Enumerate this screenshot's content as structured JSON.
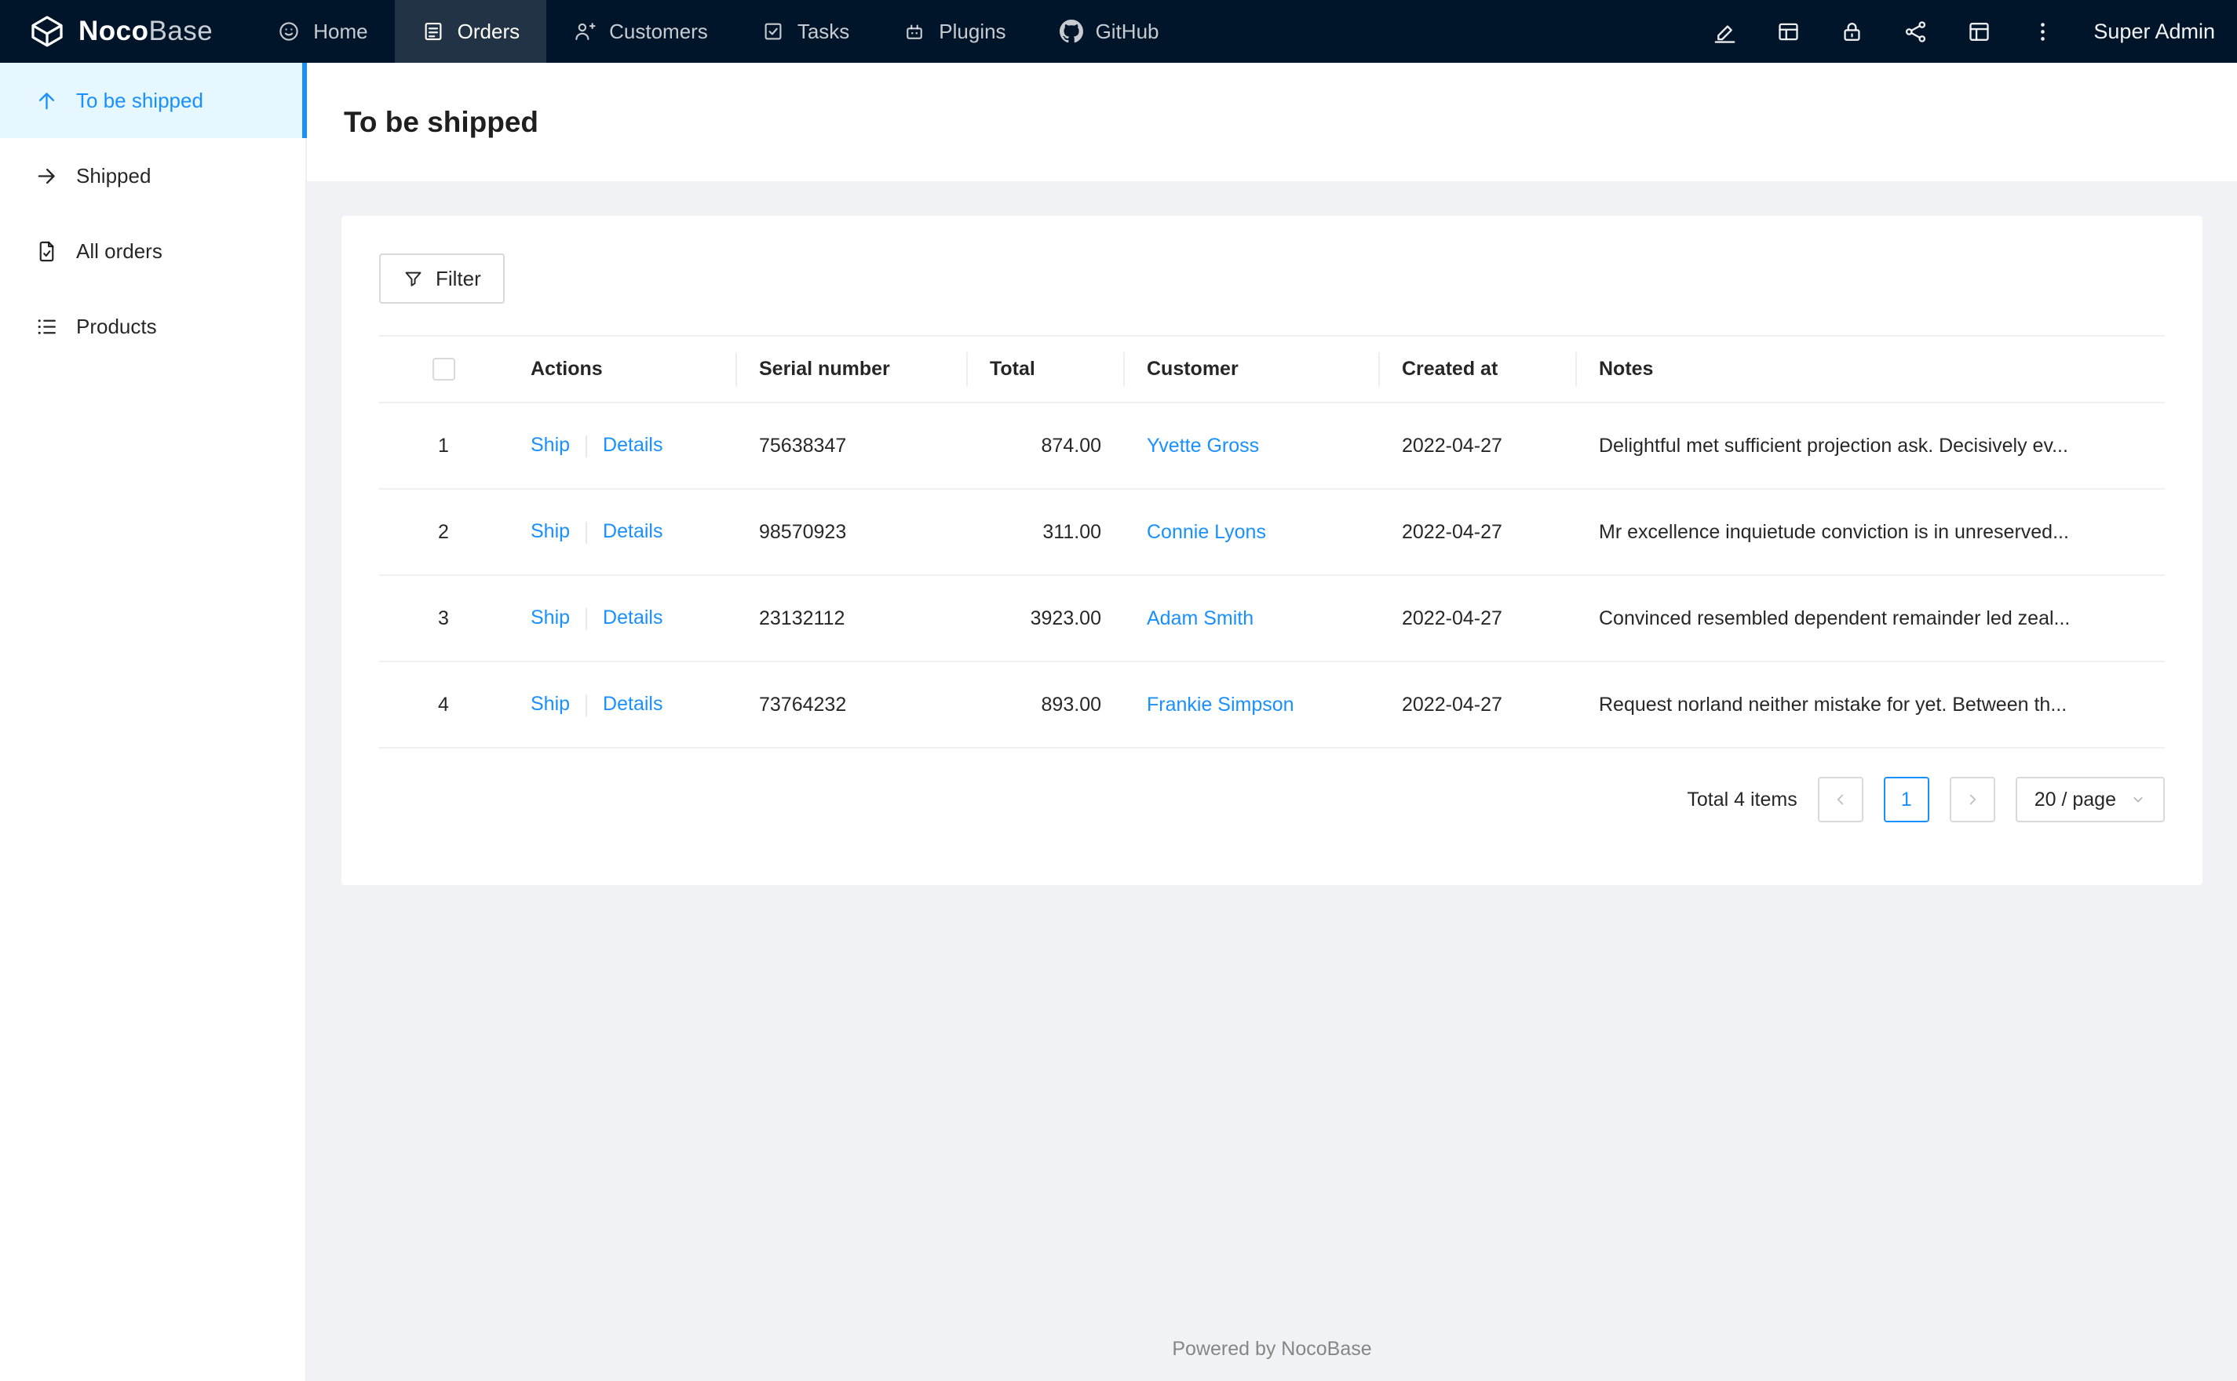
{
  "brand": {
    "name_bold": "Noco",
    "name_light": "Base"
  },
  "topnav": {
    "items": [
      {
        "label": "Home"
      },
      {
        "label": "Orders",
        "active": true
      },
      {
        "label": "Customers"
      },
      {
        "label": "Tasks"
      },
      {
        "label": "Plugins"
      },
      {
        "label": "GitHub"
      }
    ],
    "user": "Super Admin"
  },
  "sidebar": {
    "items": [
      {
        "label": "To be shipped",
        "active": true
      },
      {
        "label": "Shipped"
      },
      {
        "label": "All orders"
      },
      {
        "label": "Products"
      }
    ]
  },
  "page": {
    "title": "To be shipped"
  },
  "toolbar": {
    "filter_label": "Filter"
  },
  "table": {
    "columns": [
      "Actions",
      "Serial number",
      "Total",
      "Customer",
      "Created at",
      "Notes"
    ],
    "rows": [
      {
        "index": "1",
        "actions": [
          "Ship",
          "Details"
        ],
        "serial": "75638347",
        "total": "874.00",
        "customer": "Yvette Gross",
        "created_at": "2022-04-27",
        "notes": "Delightful met sufficient projection ask. Decisively ev..."
      },
      {
        "index": "2",
        "actions": [
          "Ship",
          "Details"
        ],
        "serial": "98570923",
        "total": "311.00",
        "customer": "Connie Lyons",
        "created_at": "2022-04-27",
        "notes": "Mr excellence inquietude conviction is in unreserved..."
      },
      {
        "index": "3",
        "actions": [
          "Ship",
          "Details"
        ],
        "serial": "23132112",
        "total": "3923.00",
        "customer": "Adam Smith",
        "created_at": "2022-04-27",
        "notes": "Convinced resembled dependent remainder led zeal..."
      },
      {
        "index": "4",
        "actions": [
          "Ship",
          "Details"
        ],
        "serial": "73764232",
        "total": "893.00",
        "customer": "Frankie Simpson",
        "created_at": "2022-04-27",
        "notes": "Request norland neither mistake for yet. Between th..."
      }
    ]
  },
  "pagination": {
    "total_text": "Total 4 items",
    "current_page": "1",
    "page_size": "20 / page"
  },
  "footer": {
    "text": "Powered by NocoBase"
  },
  "colors": {
    "accent": "#1890ff",
    "topnav_bg": "#001529",
    "active_menu_bg": "#e6f7ff",
    "link": "#1890ff",
    "border": "#f0f0f0"
  }
}
